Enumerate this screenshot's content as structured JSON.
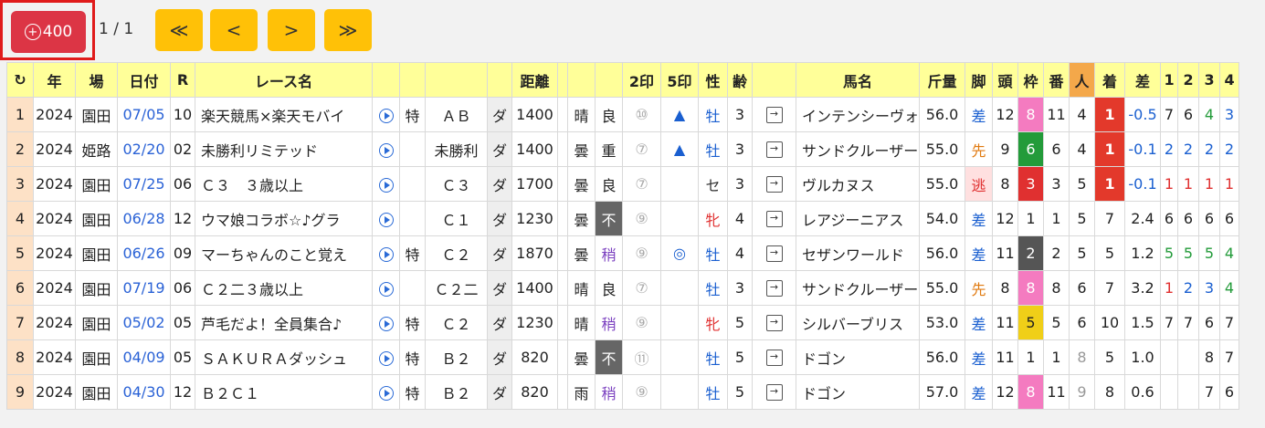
{
  "toolbar": {
    "add_label": "400",
    "pager_text": "1 / 1",
    "first_icon": "≪",
    "prev_icon": "<",
    "next_icon": ">",
    "last_icon": "≫"
  },
  "headers": [
    "↻",
    "年",
    "場",
    "日付",
    "R",
    "レース名",
    "",
    "",
    "",
    "",
    "距離",
    "",
    "",
    "2印",
    "5印",
    "性",
    "齢",
    "",
    "馬名",
    "斤量",
    "脚",
    "頭",
    "枠",
    "番",
    "人",
    "着",
    "差",
    "1",
    "2",
    "3",
    "4"
  ],
  "rows": [
    {
      "no": "1",
      "year": "2024",
      "place": "園田",
      "date": "07/05",
      "r": "10",
      "race": "楽天競馬×楽天モバイ",
      "toku": "特",
      "cls": "ＡＢ",
      "surf": "ダ",
      "dist": "1400",
      "weather": "晴",
      "track": "良",
      "mk2": "⑩",
      "mk5": "▲",
      "sex": "牡",
      "age": "3",
      "horse": "インテンシーヴォ",
      "kin": "56.0",
      "kyaku": "差",
      "tou": "12",
      "waku": "8",
      "ban": "11",
      "nin": "4",
      "chaku": "1",
      "sa": "-0.5",
      "c1": "7",
      "c2": "6",
      "c3": "4",
      "c4": "3"
    },
    {
      "no": "2",
      "year": "2024",
      "place": "姫路",
      "date": "02/20",
      "r": "02",
      "race": "未勝利リミテッド",
      "toku": "",
      "cls": "未勝利",
      "surf": "ダ",
      "dist": "1400",
      "weather": "曇",
      "track": "重",
      "mk2": "⑦",
      "mk5": "▲",
      "sex": "牡",
      "age": "3",
      "horse": "サンドクルーザー",
      "kin": "55.0",
      "kyaku": "先",
      "tou": "9",
      "waku": "6",
      "ban": "6",
      "nin": "4",
      "chaku": "1",
      "sa": "-0.1",
      "c1": "2",
      "c2": "2",
      "c3": "2",
      "c4": "2"
    },
    {
      "no": "3",
      "year": "2024",
      "place": "園田",
      "date": "07/25",
      "r": "06",
      "race": "Ｃ３　３歳以上",
      "toku": "",
      "cls": "Ｃ３",
      "surf": "ダ",
      "dist": "1700",
      "weather": "曇",
      "track": "良",
      "mk2": "⑦",
      "mk5": "",
      "sex": "セ",
      "age": "3",
      "horse": "ヴルカヌス",
      "kin": "55.0",
      "kyaku": "逃",
      "tou": "8",
      "waku": "3",
      "ban": "3",
      "nin": "5",
      "chaku": "1",
      "sa": "-0.1",
      "c1": "1",
      "c2": "1",
      "c3": "1",
      "c4": "1"
    },
    {
      "no": "4",
      "year": "2024",
      "place": "園田",
      "date": "06/28",
      "r": "12",
      "race": "ウマ娘コラボ☆♪グラ",
      "toku": "",
      "cls": "Ｃ１",
      "surf": "ダ",
      "dist": "1230",
      "weather": "曇",
      "track": "不",
      "mk2": "⑨",
      "mk5": "",
      "sex": "牝",
      "age": "4",
      "horse": "レアジーニアス",
      "kin": "54.0",
      "kyaku": "差",
      "tou": "12",
      "waku": "1",
      "ban": "1",
      "nin": "5",
      "chaku": "7",
      "sa": "2.4",
      "c1": "6",
      "c2": "6",
      "c3": "6",
      "c4": "6"
    },
    {
      "no": "5",
      "year": "2024",
      "place": "園田",
      "date": "06/26",
      "r": "09",
      "race": "マーちゃんのこと覚え",
      "toku": "特",
      "cls": "Ｃ２",
      "surf": "ダ",
      "dist": "1870",
      "weather": "曇",
      "track": "稍",
      "mk2": "⑨",
      "mk5": "◎",
      "sex": "牡",
      "age": "4",
      "horse": "セザンワールド",
      "kin": "56.0",
      "kyaku": "差",
      "tou": "11",
      "waku": "2",
      "ban": "2",
      "nin": "5",
      "chaku": "5",
      "sa": "1.2",
      "c1": "5",
      "c2": "5",
      "c3": "5",
      "c4": "4"
    },
    {
      "no": "6",
      "year": "2024",
      "place": "園田",
      "date": "07/19",
      "r": "06",
      "race": "Ｃ２二３歳以上",
      "toku": "",
      "cls": "Ｃ２二",
      "surf": "ダ",
      "dist": "1400",
      "weather": "晴",
      "track": "良",
      "mk2": "⑦",
      "mk5": "",
      "sex": "牡",
      "age": "3",
      "horse": "サンドクルーザー",
      "kin": "55.0",
      "kyaku": "先",
      "tou": "8",
      "waku": "8",
      "ban": "8",
      "nin": "6",
      "chaku": "7",
      "sa": "3.2",
      "c1": "1",
      "c2": "2",
      "c3": "3",
      "c4": "4"
    },
    {
      "no": "7",
      "year": "2024",
      "place": "園田",
      "date": "05/02",
      "r": "05",
      "race": "芦毛だよ！全員集合♪",
      "toku": "特",
      "cls": "Ｃ２",
      "surf": "ダ",
      "dist": "1230",
      "weather": "晴",
      "track": "稍",
      "mk2": "⑨",
      "mk5": "",
      "sex": "牝",
      "age": "5",
      "horse": "シルバーブリス",
      "kin": "53.0",
      "kyaku": "差",
      "tou": "11",
      "waku": "5",
      "ban": "5",
      "nin": "6",
      "chaku": "10",
      "sa": "1.5",
      "c1": "7",
      "c2": "7",
      "c3": "6",
      "c4": "7"
    },
    {
      "no": "8",
      "year": "2024",
      "place": "園田",
      "date": "04/09",
      "r": "05",
      "race": "ＳＡＫＵＲＡダッシュ",
      "toku": "特",
      "cls": "Ｂ２",
      "surf": "ダ",
      "dist": "820",
      "weather": "曇",
      "track": "不",
      "mk2": "⑪",
      "mk5": "",
      "sex": "牡",
      "age": "5",
      "horse": "ドゴン",
      "kin": "56.0",
      "kyaku": "差",
      "tou": "11",
      "waku": "1",
      "ban": "1",
      "nin": "8",
      "chaku": "5",
      "sa": "1.0",
      "c1": "",
      "c2": "",
      "c3": "8",
      "c4": "7"
    },
    {
      "no": "9",
      "year": "2024",
      "place": "園田",
      "date": "04/30",
      "r": "12",
      "race": "Ｂ２Ｃ１",
      "toku": "特",
      "cls": "Ｂ２",
      "surf": "ダ",
      "dist": "820",
      "weather": "雨",
      "track": "稍",
      "mk2": "⑨",
      "mk5": "",
      "sex": "牡",
      "age": "5",
      "horse": "ドゴン",
      "kin": "57.0",
      "kyaku": "差",
      "tou": "12",
      "waku": "8",
      "ban": "11",
      "nin": "9",
      "chaku": "8",
      "sa": "0.6",
      "c1": "",
      "c2": "",
      "c3": "7",
      "c4": "6"
    }
  ]
}
